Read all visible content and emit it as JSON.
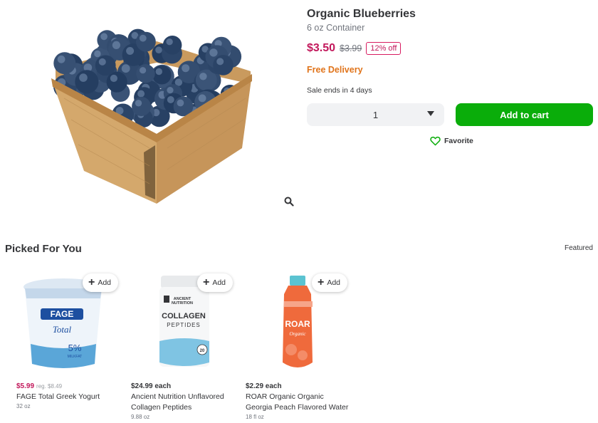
{
  "product": {
    "title": "Organic Blueberries",
    "size": "6 oz Container",
    "price": "$3.50",
    "original_price": "$3.99",
    "discount": "12% off",
    "delivery": "Free Delivery",
    "sale_ends": "Sale ends in 4 days",
    "quantity": "1",
    "add_to_cart": "Add to cart",
    "favorite": "Favorite",
    "image": "blueberries-in-basket"
  },
  "section": {
    "title": "Picked For You",
    "sort": "Featured"
  },
  "recommendations": [
    {
      "price": "$5.99",
      "regular": "reg. $8.49",
      "name_line1": "FAGE Total Greek Yogurt",
      "name_line2": "",
      "size": "32 oz",
      "add_label": "Add",
      "image": "fage-yogurt-tub"
    },
    {
      "price": "$24.99 each",
      "regular": "",
      "name_line1": "Ancient Nutrition Unflavored",
      "name_line2": "Collagen Peptides",
      "size": "9.88 oz",
      "add_label": "Add",
      "image": "collagen-canister"
    },
    {
      "price": "$2.29 each",
      "regular": "",
      "name_line1": "ROAR Organic Organic",
      "name_line2": "Georgia Peach Flavored Water",
      "size": "18 fl oz",
      "add_label": "Add",
      "image": "roar-bottle"
    }
  ],
  "fage_label": {
    "brand": "FAGE",
    "sub": "Total",
    "pct": "5%",
    "fat": "MILKFAT"
  },
  "collagen_label": {
    "brand_line1": "ANCIENT",
    "brand_line2": "NUTRITION",
    "main": "COLLAGEN",
    "sub": "PEPTIDES",
    "badge": "20"
  },
  "roar_label": {
    "brand": "ROAR",
    "sub": "Organic"
  },
  "colors": {
    "accent_green": "#0aad0a",
    "sale_pink": "#c2185b",
    "delivery_orange": "#e0741b"
  },
  "icons": {
    "zoom": "magnifier-icon",
    "favorite": "heart-outline-icon",
    "add": "plus-icon",
    "dropdown": "caret-down-icon"
  }
}
